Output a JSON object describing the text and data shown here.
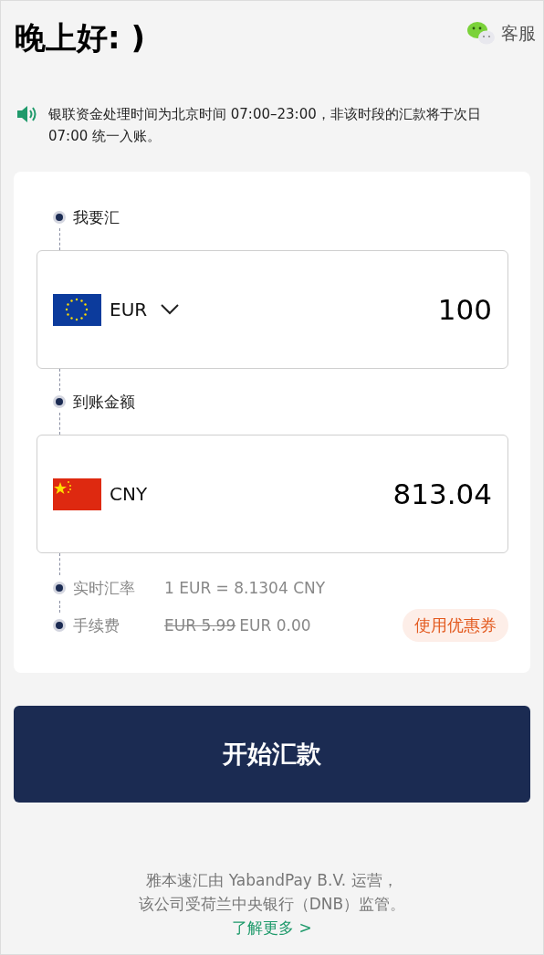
{
  "header": {
    "greeting": "晚上好: )",
    "support": "客服"
  },
  "notice": "银联资金处理时间为北京时间 07:00–23:00，非该时段的汇款将于次日07:00 统一入账。",
  "transfer": [
    {
      "label": "我要汇",
      "kind": "eu",
      "currency": "EUR",
      "dropdown": true,
      "amount": "100"
    },
    {
      "label": "到账金额",
      "kind": "cn",
      "currency": "CNY",
      "dropdown": false,
      "amount": "813.04"
    }
  ],
  "rate": {
    "label": "实时汇率",
    "value": "1 EUR = 8.1304 CNY"
  },
  "fee": {
    "label": "手续费",
    "original": "EUR 5.99",
    "current": "EUR 0.00",
    "coupon": "使用优惠券"
  },
  "submit": "开始汇款",
  "footer": {
    "lines": [
      "雅本速汇由 YabandPay B.V. 运营，",
      "该公司受荷兰中央银行（DNB）监管。"
    ],
    "link": "了解更多 >"
  }
}
